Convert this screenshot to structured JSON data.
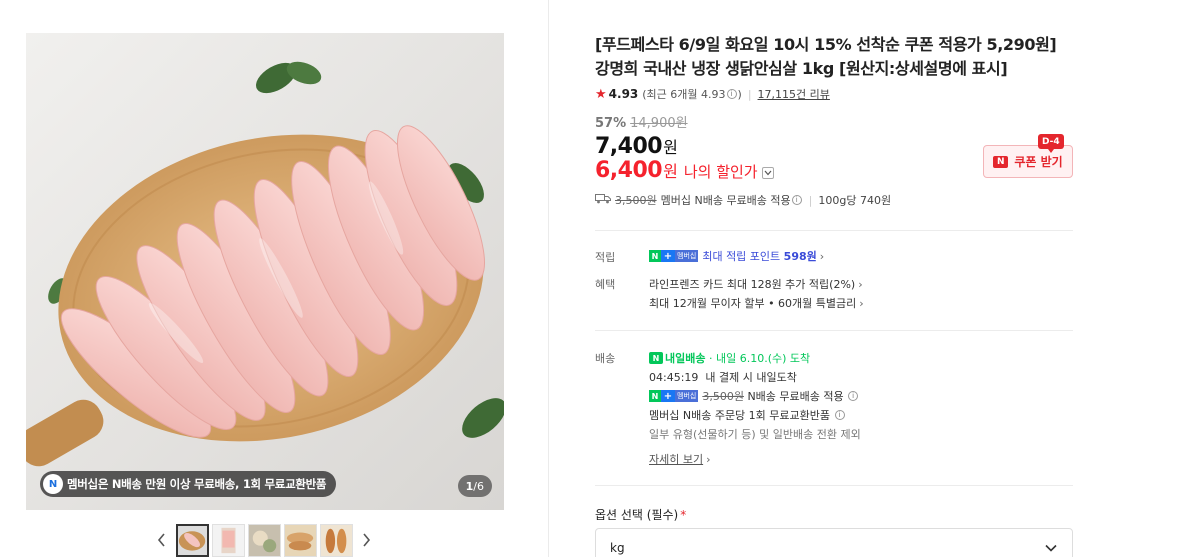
{
  "gallery": {
    "promo_badge_logo": "N",
    "promo_text": "멤버십은 N배송 만원 이상 무료배송, 1회 무료교환반품",
    "counter_current": "1",
    "counter_total": "/6",
    "prev_icon": "chevron-left-icon",
    "next_icon": "chevron-right-icon",
    "thumbnail_count": 5
  },
  "product": {
    "title": "[푸드페스타 6/9일 화요일 10시 15% 선착순 쿠폰 적용가 5,290원] 강명희 국내산 냉장 생닭안심살 1kg [원산지:상세설명에 표시]",
    "rating": "4.93",
    "rating_recent": "(최근 6개월 4.93",
    "rating_info_icon": "i",
    "rating_recent_close": ")",
    "review_count": "17,115건 리뷰",
    "discount_pct": "57%",
    "original_price": "14,900원",
    "price": "7,400",
    "price_unit": "원",
    "my_price": "6,400",
    "my_price_unit": "원",
    "my_price_label": "나의 할인가",
    "coupon_dday": "D-4",
    "coupon_icon_text": "N",
    "coupon_label": "쿠폰 받기"
  },
  "shipping_summary": {
    "fee_original": "3,500원",
    "text": "멤버십 N배송 무료배송 적용",
    "per_unit": "100g당 740원"
  },
  "points": {
    "label": "적립",
    "membership_badge": "멤버십",
    "text_prefix": "최대 적립 포인트",
    "amount": "598원"
  },
  "benefits": {
    "label": "혜택",
    "line1": "라인프렌즈 카드 최대 128원 추가 적립(2%)",
    "line2": "최대 12개월 무이자 할부 • 60개월 특별금리"
  },
  "delivery": {
    "label": "배송",
    "badge": "내일배송",
    "arrival": "· 내일 6.10.(수) 도착",
    "countdown": "04:45:19",
    "countdown_text": "내 결제 시 내일도착",
    "membership_badge": "멤버십",
    "fee_original": "3,500원",
    "fee_text": "N배송 무료배송 적용",
    "return_text": "멤버십 N배송 주문당 1회 무료교환반품",
    "exclusion": "일부 유형(선물하기 등) 및 일반배송 전환 제외",
    "more_link": "자세히 보기"
  },
  "option": {
    "label": "옵션 선택 (필수)",
    "required_mark": "*",
    "selected": "kg"
  },
  "colors": {
    "accent_red": "#f5222d",
    "naver_green": "#03c75a",
    "points_blue": "#3a4bd8"
  }
}
